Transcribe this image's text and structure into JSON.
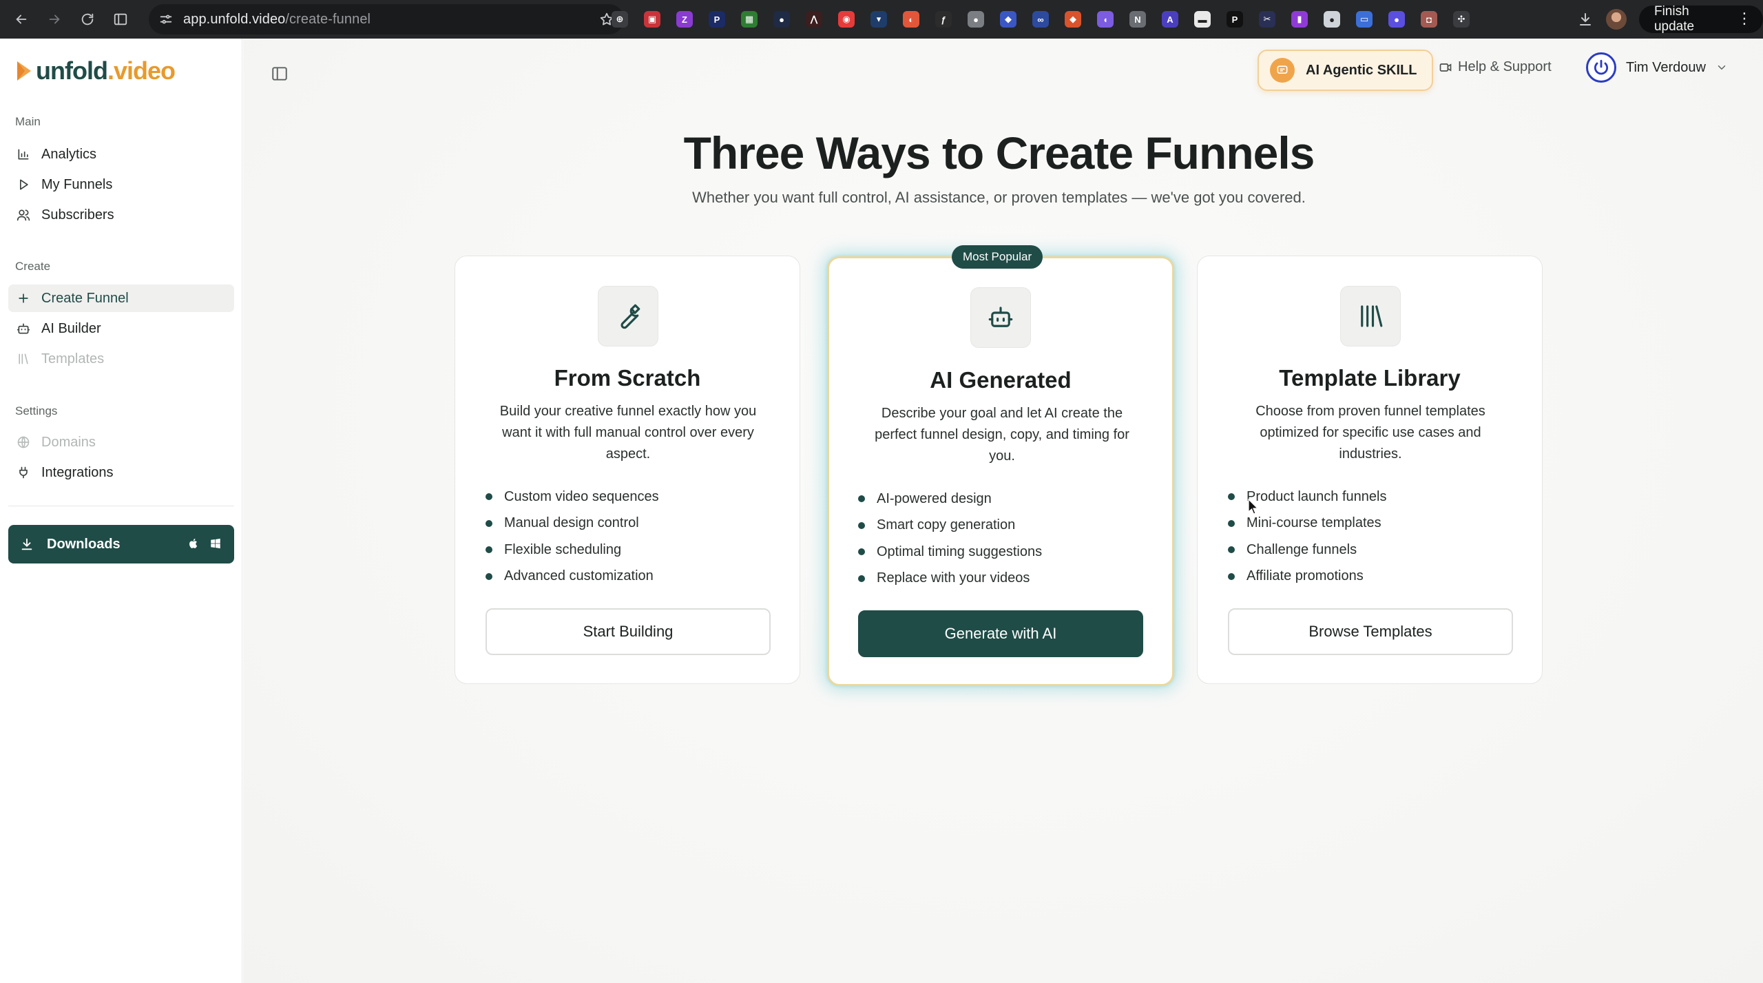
{
  "browser": {
    "url_host": "app.unfold.video",
    "url_path": "/create-funnel",
    "finish_update_label": "Finish update",
    "extensions": [
      {
        "icon": "chrome-ext-icon",
        "color": "#3b3d41",
        "glyph": "⊕"
      },
      {
        "icon": "pdf-ext-icon",
        "color": "#c9343a",
        "glyph": "▣"
      },
      {
        "icon": "zotero-ext-icon",
        "color": "#8a3bd1",
        "glyph": "Z"
      },
      {
        "icon": "paypal-ext-icon",
        "color": "#1b2b66",
        "glyph": "P"
      },
      {
        "icon": "screen-ext-icon",
        "color": "#2e7d32",
        "glyph": "▦"
      },
      {
        "icon": "dots-ext-icon",
        "color": "#1f2a44",
        "glyph": "●"
      },
      {
        "icon": "red-ext-icon",
        "color": "#3b1e1e",
        "glyph": "⋀"
      },
      {
        "icon": "record-ext-icon",
        "color": "#e63b3b",
        "glyph": "◉"
      },
      {
        "icon": "shield-ext-icon",
        "color": "#1e3d6b",
        "glyph": "▾"
      },
      {
        "icon": "orange-ext-icon",
        "color": "#e2573a",
        "glyph": "◐"
      },
      {
        "icon": "fx-ext-icon",
        "color": "#2c2c2c",
        "glyph": "ƒ"
      },
      {
        "icon": "gray-ext-icon",
        "color": "#7b7e83",
        "glyph": "●"
      },
      {
        "icon": "tag-ext-icon",
        "color": "#3b57c4",
        "glyph": "◆"
      },
      {
        "icon": "link-ext-icon",
        "color": "#2c4a9e",
        "glyph": "∞"
      },
      {
        "icon": "fox-ext-icon",
        "color": "#d9532c",
        "glyph": "◆"
      },
      {
        "icon": "feather-ext-icon",
        "color": "#7c5ce0",
        "glyph": "◖"
      },
      {
        "icon": "n-ext-icon",
        "color": "#6a6e73",
        "glyph": "N"
      },
      {
        "icon": "ai-ext-icon",
        "color": "#4b3fbf",
        "glyph": "A"
      },
      {
        "icon": "page-ext-icon",
        "color": "#e9e9e9",
        "glyph": "▬"
      },
      {
        "icon": "p-ext-icon",
        "color": "#111111",
        "glyph": "P"
      },
      {
        "icon": "scissors-ext-icon",
        "color": "#2a2f55",
        "glyph": "✂"
      },
      {
        "icon": "bookmark-ext-icon",
        "color": "#8e3bd6",
        "glyph": "▮"
      },
      {
        "icon": "chat-ext-icon",
        "color": "#cfd3da",
        "glyph": "●"
      },
      {
        "icon": "screen-share-ext-icon",
        "color": "#3c6fd8",
        "glyph": "▭"
      },
      {
        "icon": "circle-ext-icon",
        "color": "#5b4fe0",
        "glyph": "●"
      },
      {
        "icon": "car-ext-icon",
        "color": "#a35a52",
        "glyph": "◘"
      },
      {
        "icon": "puzzle-ext-icon",
        "color": "#3a3c40",
        "glyph": "✣"
      }
    ]
  },
  "brand": {
    "name_part1": "unfold",
    "name_part2": ".video"
  },
  "sidebar": {
    "sections": [
      {
        "label": "Main"
      },
      {
        "label": "Create"
      },
      {
        "label": "Settings"
      }
    ],
    "items": [
      {
        "label": "Analytics"
      },
      {
        "label": "My Funnels"
      },
      {
        "label": "Subscribers"
      },
      {
        "label": "Create Funnel"
      },
      {
        "label": "AI Builder"
      },
      {
        "label": "Templates"
      },
      {
        "label": "Domains"
      },
      {
        "label": "Integrations"
      }
    ],
    "downloads_label": "Downloads"
  },
  "header": {
    "agentic_label": "AI Agentic SKILL",
    "help_label": "Help & Support",
    "user_name": "Tim Verdouw"
  },
  "hero": {
    "title": "Three Ways to Create Funnels",
    "subtitle": "Whether you want full control, AI assistance, or proven templates — we've got you covered."
  },
  "cards": [
    {
      "title": "From Scratch",
      "description": "Build your creative funnel exactly how you want it with full manual control over every aspect.",
      "features": [
        "Custom video sequences",
        "Manual design control",
        "Flexible scheduling",
        "Advanced customization"
      ],
      "cta": "Start Building"
    },
    {
      "badge": "Most Popular",
      "title": "AI Generated",
      "description": "Describe your goal and let AI create the perfect funnel design, copy, and timing for you.",
      "features": [
        "AI-powered design",
        "Smart copy generation",
        "Optimal timing suggestions",
        "Replace with your videos"
      ],
      "cta": "Generate with AI"
    },
    {
      "title": "Template Library",
      "description": "Choose from proven funnel templates optimized for specific use cases and industries.",
      "features": [
        "Product launch funnels",
        "Mini-course templates",
        "Challenge funnels",
        "Affiliate promotions"
      ],
      "cta": "Browse Templates"
    }
  ],
  "colors": {
    "brand_dark": "#1f4c47",
    "brand_accent": "#e89a2c",
    "featured_glow": "#50bec8"
  }
}
